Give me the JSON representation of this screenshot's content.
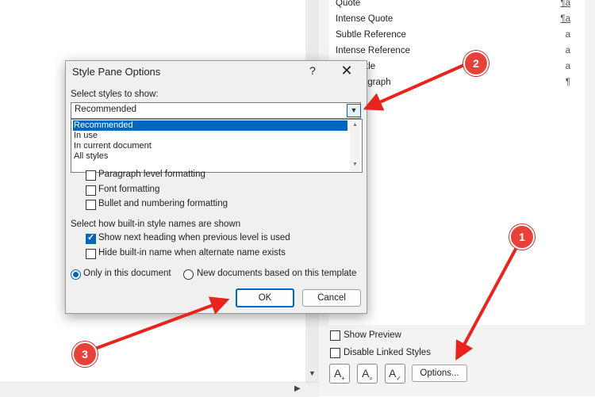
{
  "styles_pane": {
    "items": [
      {
        "label": "Quote",
        "mark": "¶a"
      },
      {
        "label": "Intense Quote",
        "mark": "¶a"
      },
      {
        "label": "Subtle Reference",
        "mark": "a"
      },
      {
        "label": "Intense Reference",
        "mark": "a"
      },
      {
        "label": "tle",
        "mark": "a"
      },
      {
        "label": "ragraph",
        "mark": "¶"
      }
    ],
    "show_preview": "Show Preview",
    "disable_linked": "Disable Linked Styles",
    "options_button": "Options..."
  },
  "dialog": {
    "title": "Style Pane Options",
    "help": "?",
    "close": "✕",
    "select_label": "Select styles to show:",
    "combo_value": "Recommended",
    "dropdown_options": [
      "Recommended",
      "In use",
      "In current document",
      "All styles"
    ],
    "formatting_options": [
      {
        "label": "Paragraph level formatting",
        "checked": false
      },
      {
        "label": "Font formatting",
        "checked": false
      },
      {
        "label": "Bullet and numbering formatting",
        "checked": false
      }
    ],
    "builtin_label": "Select how built-in style names are shown",
    "builtin_options": [
      {
        "label": "Show next heading when previous level is used",
        "checked": true
      },
      {
        "label": "Hide built-in name when alternate name exists",
        "checked": false
      }
    ],
    "radio_options": [
      {
        "label": "Only in this document",
        "selected": true
      },
      {
        "label": "New documents based on this template",
        "selected": false
      }
    ],
    "ok": "OK",
    "cancel": "Cancel"
  },
  "callouts": [
    "1",
    "2",
    "3"
  ],
  "colors": {
    "accent": "#0067c0",
    "callout": "#e8413a",
    "arrow": "#e8241c"
  }
}
